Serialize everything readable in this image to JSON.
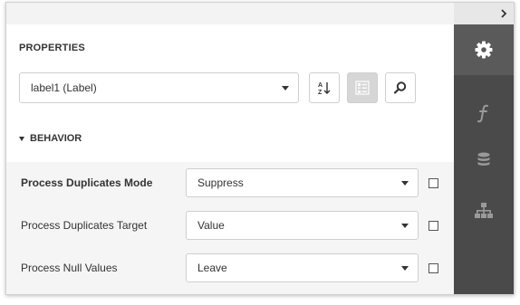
{
  "panel": {
    "title": "PROPERTIES",
    "selected_component": "label1 (Label)"
  },
  "toolbar": {
    "sort_icon": "sort-alphabetical-icon",
    "categories_icon": "categorized-view-icon",
    "search_icon": "search-icon"
  },
  "section": {
    "title": "BEHAVIOR"
  },
  "properties": [
    {
      "label": "Process Duplicates Mode",
      "value": "Suppress",
      "bold": true
    },
    {
      "label": "Process Duplicates Target",
      "value": "Value",
      "bold": false
    },
    {
      "label": "Process Null Values",
      "value": "Leave",
      "bold": false
    }
  ],
  "side_tabs": [
    {
      "icon": "gear-icon",
      "active": true
    },
    {
      "icon": "function-icon",
      "active": false
    },
    {
      "icon": "database-icon",
      "active": false
    },
    {
      "icon": "hierarchy-icon",
      "active": false
    }
  ],
  "colors": {
    "side_bar": "#4a4a4a",
    "side_bar_active": "#5a5a5a",
    "grid_background": "#f5f5f5"
  }
}
